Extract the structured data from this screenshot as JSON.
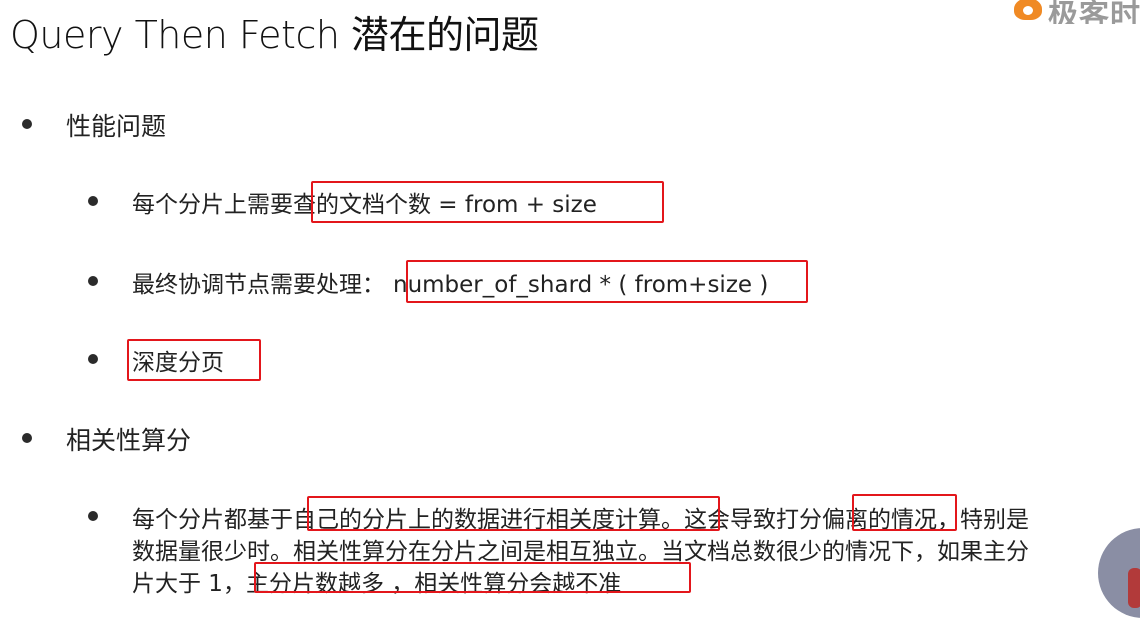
{
  "title": "Query Then Fetch 潜在的问题",
  "logo": {
    "text": "极客时",
    "icon": "flame-logo-icon",
    "color": "#f08a24"
  },
  "items": [
    {
      "label": "性能问题"
    },
    {
      "pre": "每个分片上需要",
      "boxed": "查的文档个数 =  from + size"
    },
    {
      "pre": "最终协调节点需要处理：",
      "boxed": "number_of_shard * ( from+size )"
    },
    {
      "pre": "",
      "boxed": "深度分页"
    },
    {
      "label": "相关性算分"
    }
  ],
  "relevance": {
    "line1_pre": "每个分片都基于",
    "line1_box1": "自己的分片上的数据进行相关度计算",
    "line1_mid": "。这会导致",
    "line1_box2": "打分偏离",
    "line1_post": "的情况，特别是",
    "line2": "数据量很少时。相关性算分在分片之间是相互独立。当文档总数很少的情况下，如果主分",
    "line3_pre": "片大于 1，",
    "line3_box": "主分片数越多 ，相关性算分会越不准"
  },
  "colors": {
    "highlight": "#e3161b",
    "text": "#222222"
  }
}
